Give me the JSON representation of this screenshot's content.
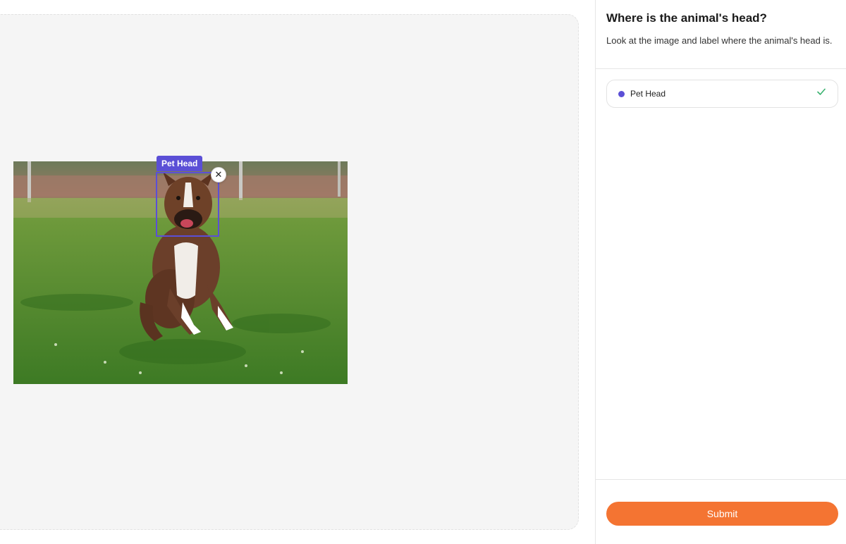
{
  "question": {
    "title": "Where is the animal's head?",
    "description": "Look at the image and label where the animal's head is."
  },
  "annotation": {
    "label": "Pet Head",
    "close_icon": "close-icon",
    "color": "#5b4fd6"
  },
  "labels": [
    {
      "name": "Pet Head",
      "color": "#5b4fd6",
      "status_icon": "checkmark-icon",
      "status_color": "#3cb371"
    }
  ],
  "footer": {
    "submit_label": "Submit",
    "submit_color": "#f47432"
  }
}
